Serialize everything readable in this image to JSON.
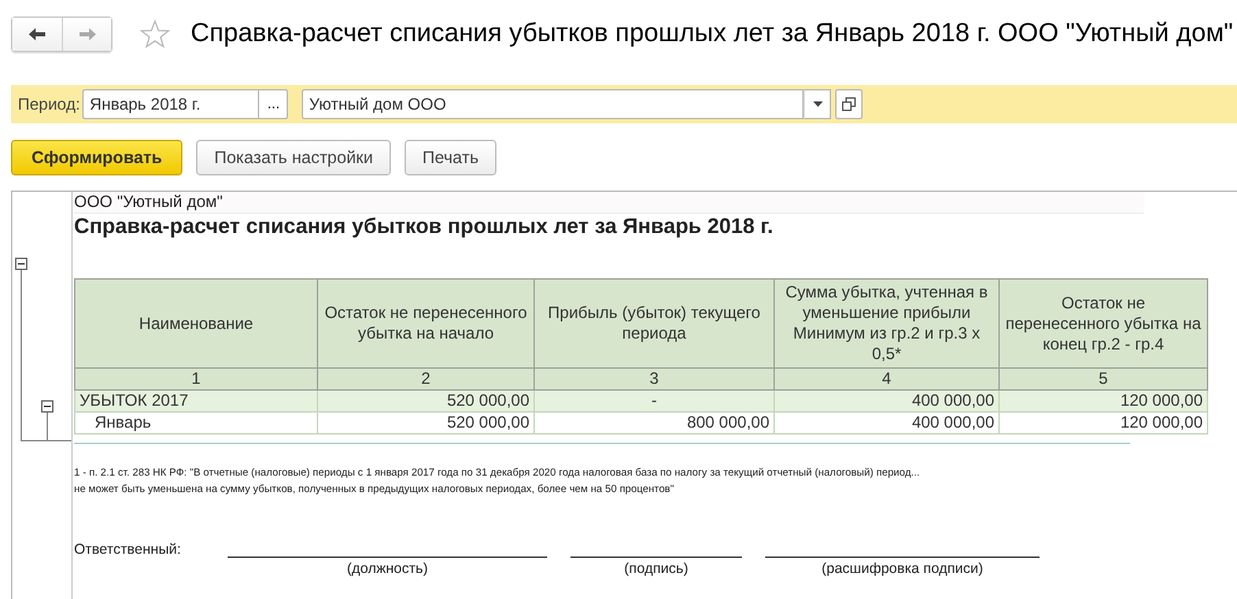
{
  "navigation": [
    {
      "kind": "back",
      "disabled": false
    },
    {
      "kind": "forward",
      "disabled": true
    }
  ],
  "favorite": false,
  "window": {
    "title": "Справка-расчет списания убытков прошлых лет за Январь 2018 г. ООО \"Уютный дом\""
  },
  "filters": {
    "period_label": "Период:",
    "period_value": "Январь 2018 г.",
    "period_button": "...",
    "organization_value": "Уютный дом ООО"
  },
  "buttons": [
    {
      "label": "Сформировать",
      "kind": "primary"
    },
    {
      "label": "Показать настройки",
      "kind": "normal"
    },
    {
      "label": "Печать",
      "kind": "normal"
    }
  ],
  "report": {
    "expanded": true,
    "organization": "ООО \"Уютный дом\"",
    "title": "Справка-расчет списания убытков прошлых лет за Январь 2018 г.",
    "columns": [
      {
        "heading": "Наименование",
        "number": "1"
      },
      {
        "heading": "Остаток не перенесенного убытка на начало",
        "number": "2"
      },
      {
        "heading": "Прибыль (убыток) текущего периода",
        "number": "3"
      },
      {
        "heading": "Сумма убытка, учтенная в уменьшение прибыли Минимум из гр.2 и гр.3 х 0,5*",
        "number": "4"
      },
      {
        "heading": "Остаток не перенесенного убытка на конец гр.2 - гр.4",
        "number": "5"
      }
    ],
    "rows": [
      {
        "kind": "group",
        "expanded": true,
        "cells": [
          "УБЫТОК 2017",
          "520 000,00",
          "-",
          "400 000,00",
          "120 000,00"
        ]
      },
      {
        "kind": "item",
        "cells": [
          "Январь",
          "520 000,00",
          "800 000,00",
          "400 000,00",
          "120 000,00"
        ]
      }
    ],
    "footnote": [
      "1 - п. 2.1 ст. 283 НК РФ: \"В отчетные (налоговые) периоды с 1 января 2017 года по 31 декабря 2020 года налоговая база по налогу за текущий отчетный (налоговый) период...",
      "не может быть уменьшена на сумму убытков, полученных в предыдущих налоговых периодах, более чем на 50 процентов\""
    ],
    "signature": {
      "label": "Ответственный:",
      "fields": [
        "(должность)",
        "(подпись)",
        "(расшифровка подписи)"
      ]
    }
  }
}
